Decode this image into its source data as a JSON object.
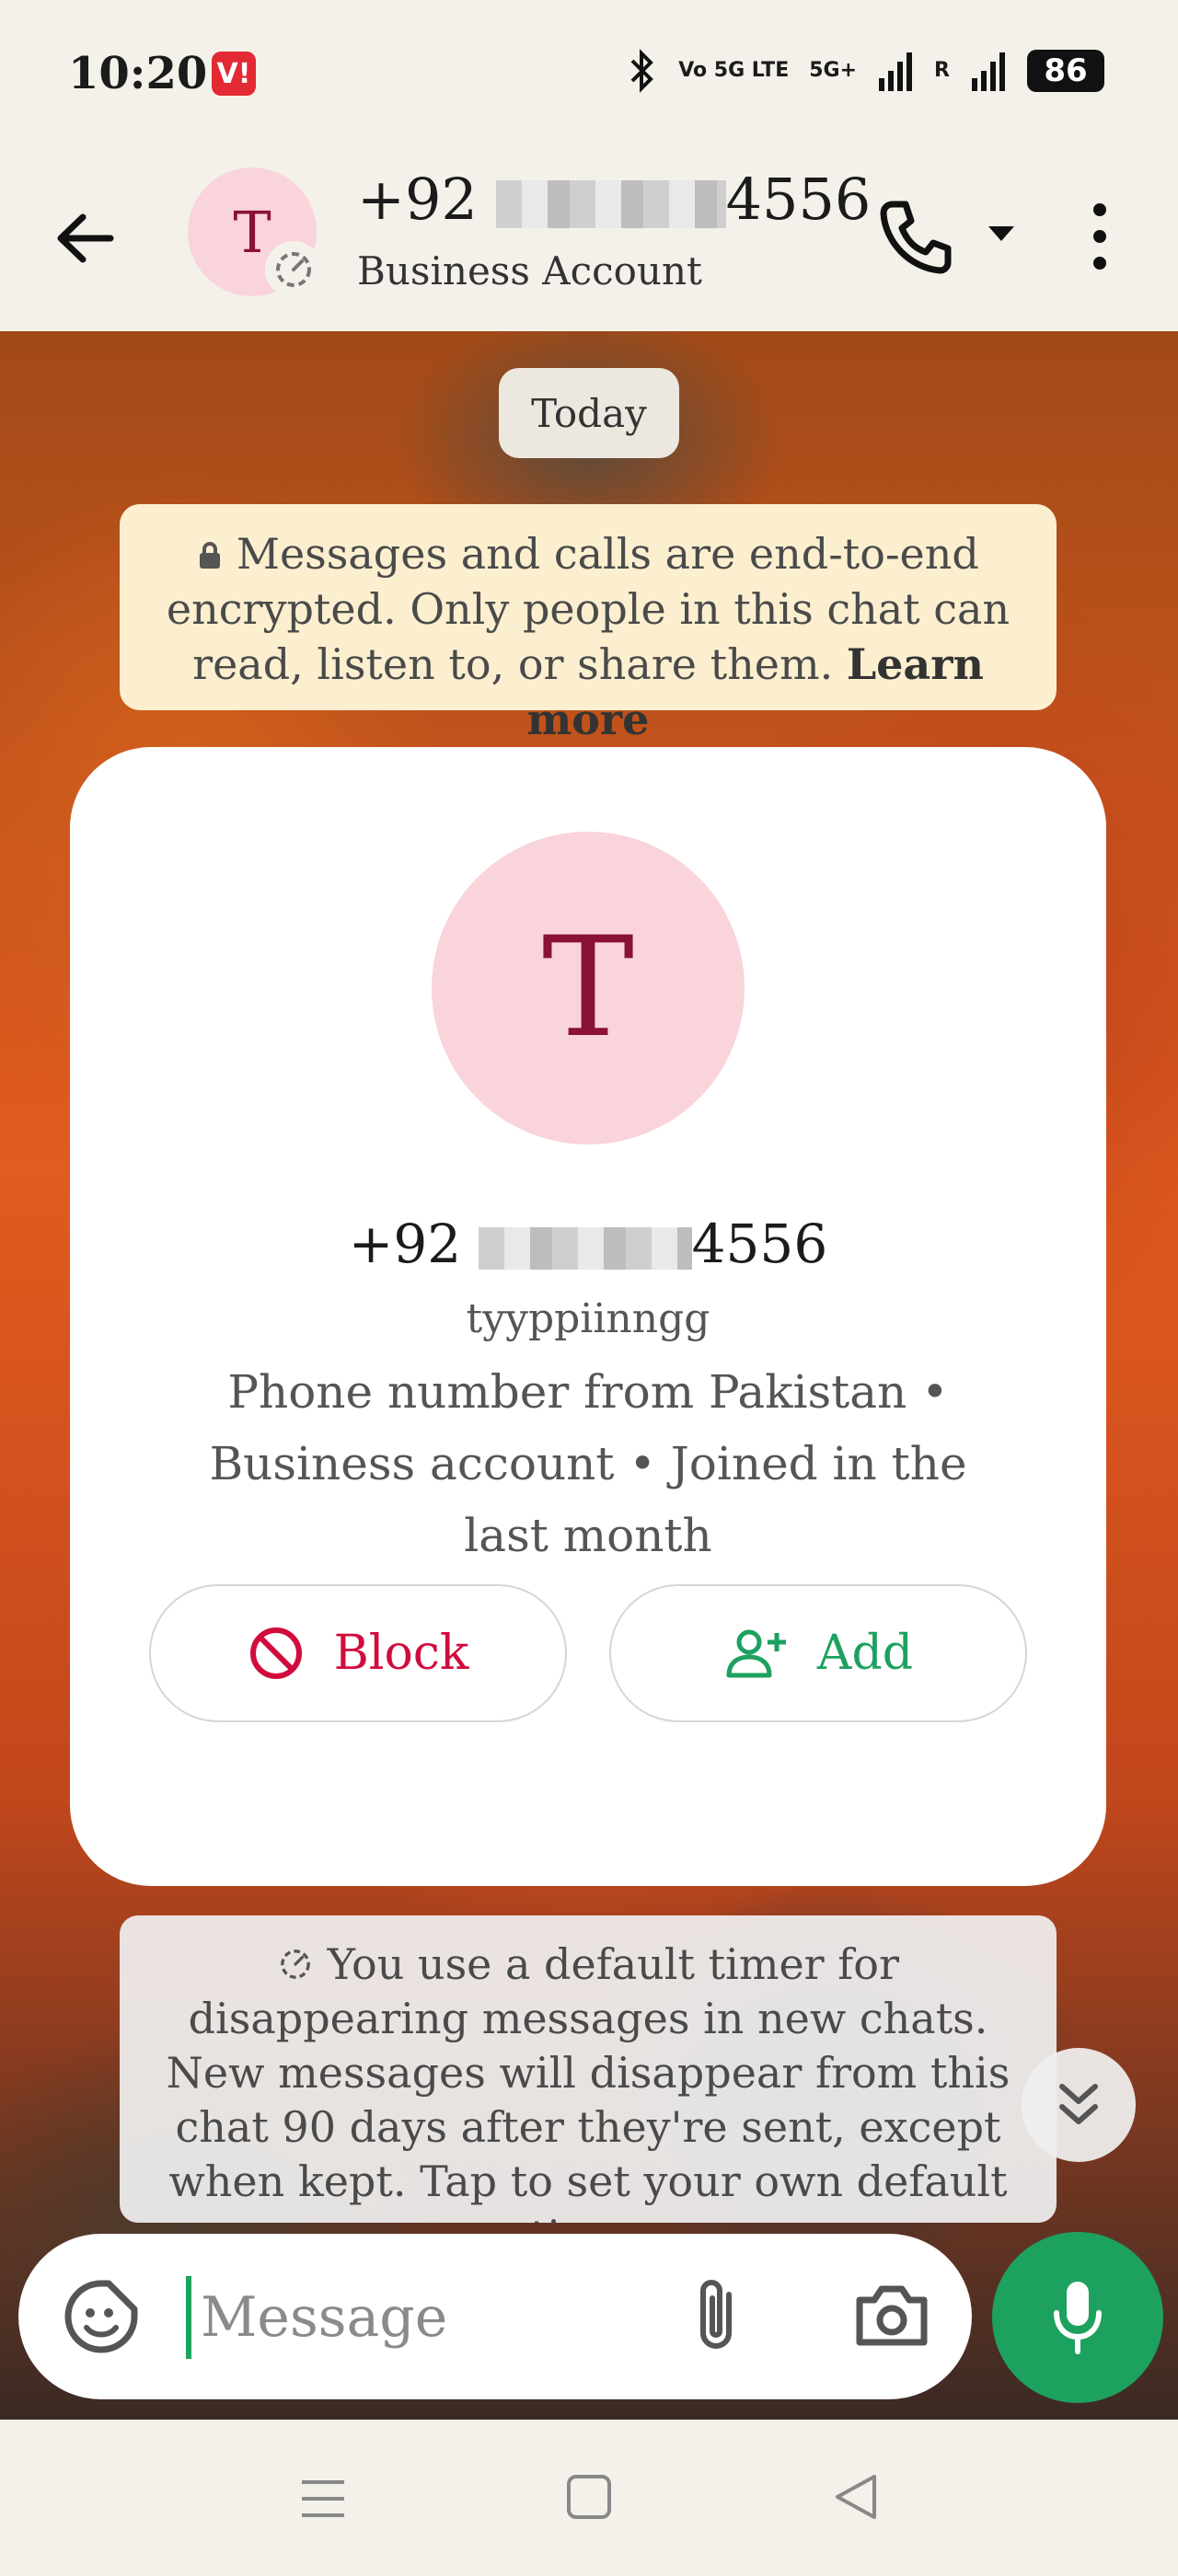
{
  "status_bar": {
    "time": "10:20",
    "carrier_badge": "V!",
    "network_1": "Vo 5G LTE",
    "network_2": "5G+",
    "roaming": "R",
    "battery": "86"
  },
  "header": {
    "avatar_letter": "T",
    "phone_prefix": "+92",
    "phone_suffix": "4556",
    "subtitle": "Business Account"
  },
  "chat": {
    "date_chip": "Today",
    "encryption_notice": "Messages and calls are end-to-end encrypted. Only people in this chat can read, listen to, or share them.",
    "learn_more": "Learn more",
    "contact_card": {
      "avatar_letter": "T",
      "phone_prefix": "+92",
      "phone_suffix": "4556",
      "username": "tyyppiinngg",
      "description": "Phone number from Pakistan • Business account • Joined in the last month",
      "block_label": "Block",
      "add_label": "Add"
    },
    "timer_notice": "You use a default timer for disappearing messages in new chats. New messages will disappear from this chat 90 days after they're sent, except when kept. Tap to set your own default timer"
  },
  "composer": {
    "placeholder": "Message"
  },
  "colors": {
    "accent_green": "#1da15f",
    "block_red": "#d10c3d",
    "avatar_bg": "#f9d4da",
    "avatar_fg": "#8a1236"
  }
}
